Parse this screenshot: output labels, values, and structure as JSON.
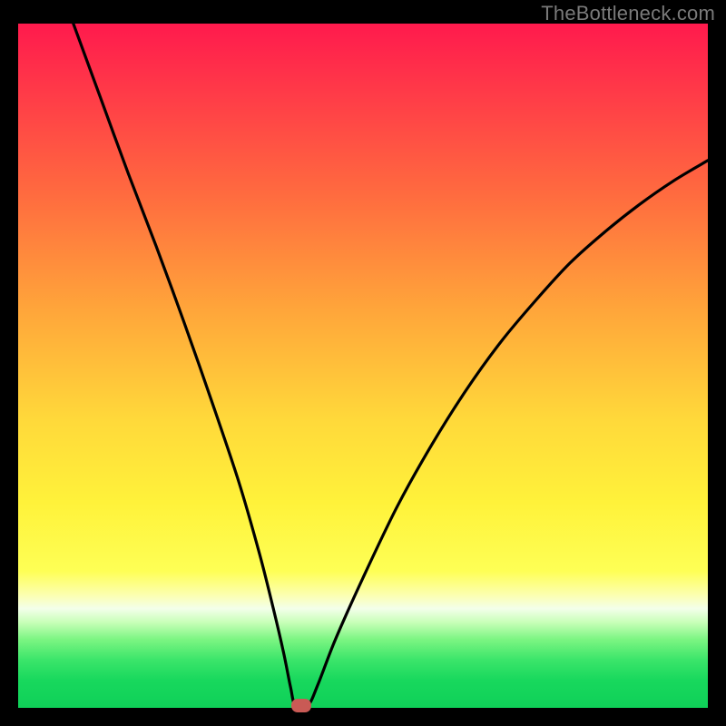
{
  "watermark": "TheBottleneck.com",
  "chart_data": {
    "type": "line",
    "title": "",
    "xlabel": "",
    "ylabel": "",
    "xlim": [
      0,
      100
    ],
    "ylim": [
      0,
      100
    ],
    "grid": false,
    "legend": false,
    "background_gradient": {
      "top": "#ff1a4d",
      "mid": "#ffe43a",
      "bottom": "#0fd058"
    },
    "series": [
      {
        "name": "bottleneck-curve",
        "x": [
          8,
          12,
          16,
          20,
          24,
          28,
          32,
          35,
          37,
          38.5,
          39.5,
          40.2,
          42,
          43.5,
          46,
          50,
          55,
          60,
          65,
          70,
          75,
          80,
          85,
          90,
          95,
          100
        ],
        "y": [
          100,
          89,
          78,
          67.5,
          56.5,
          45,
          33,
          22.5,
          14.5,
          8,
          3,
          0.3,
          0.3,
          3.5,
          10,
          19,
          29.5,
          38.5,
          46.5,
          53.5,
          59.5,
          65,
          69.5,
          73.5,
          77,
          80
        ]
      }
    ],
    "optimum_marker": {
      "x": 41,
      "y": 0.3
    },
    "curve_color": "#000000"
  }
}
